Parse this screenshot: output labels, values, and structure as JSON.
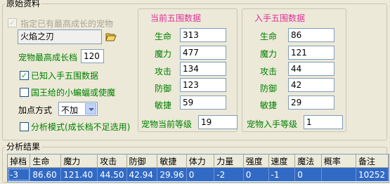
{
  "original": {
    "legend": "原始资料",
    "highest_growth_check": {
      "label": "指定已有最高成长的宠物",
      "checked": true,
      "enabled": false
    },
    "pet_name_value": "火焰之刃",
    "max_growth_label": "宠物最高成长档",
    "max_growth_value": "120",
    "known_stats_check": {
      "label": "已知入手五围数据",
      "checked": true
    },
    "king_gift_check": {
      "label": "国王给的小蝙蝠或使魔",
      "checked": false
    },
    "add_point_label": "加点方式",
    "add_point_value": "不加",
    "analysis_mode_check": {
      "label": "分析模式(成长档不足选用)",
      "checked": false
    }
  },
  "current_stats": {
    "title": "当前五围数据",
    "rows": [
      {
        "label": "生命",
        "value": "313"
      },
      {
        "label": "魔力",
        "value": "477"
      },
      {
        "label": "攻击",
        "value": "134"
      },
      {
        "label": "防御",
        "value": "123"
      },
      {
        "label": "敏捷",
        "value": "59"
      }
    ],
    "level_label": "宠物当前等级",
    "level_value": "19"
  },
  "initial_stats": {
    "title": "入手五围数据",
    "rows": [
      {
        "label": "生命",
        "value": "86"
      },
      {
        "label": "魔力",
        "value": "121"
      },
      {
        "label": "攻击",
        "value": "44"
      },
      {
        "label": "防御",
        "value": "42"
      },
      {
        "label": "敏捷",
        "value": "29"
      }
    ],
    "level_label": "宠物入手等级",
    "level_value": "1"
  },
  "analysis": {
    "legend": "分析结果",
    "columns": [
      "掉档",
      "生命",
      "魔力",
      "攻击",
      "防御",
      "敏捷",
      "体力",
      "力量",
      "强度",
      "速度",
      "魔法",
      "概率",
      "备注"
    ],
    "rows": [
      [
        "-3",
        "86.60",
        "121.40",
        "44.50",
        "42.94",
        "29.96",
        "0",
        "-2",
        "0",
        "-1",
        "0",
        "",
        "10252"
      ]
    ]
  },
  "colors": {
    "accent_text": "#008000",
    "section_title": "#e0309a",
    "selection": "#316ac5"
  },
  "icons": {
    "open_folder": "folder-open-icon"
  }
}
